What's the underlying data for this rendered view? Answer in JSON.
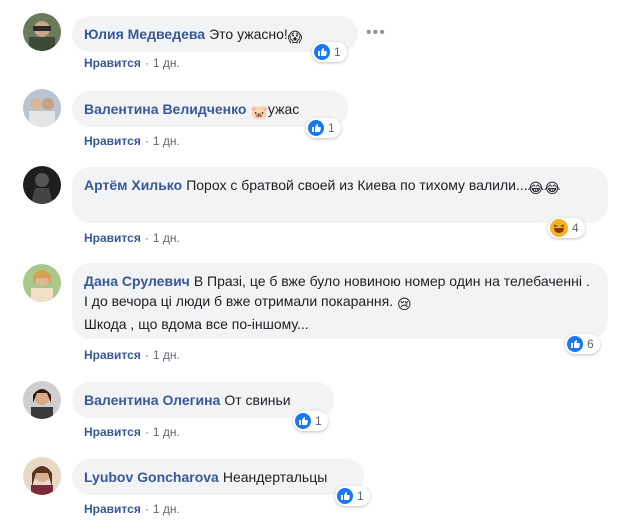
{
  "comments": [
    {
      "author": "Юлия Медведева",
      "text": "Это ужасно!",
      "emoji": "😱",
      "like_label": "Нравится",
      "age": "1 дн.",
      "reaction_count": "1",
      "reaction_type": "like"
    },
    {
      "author": "Валентина Велидченко",
      "text": "ужас",
      "emoji_before": "🐷",
      "like_label": "Нравится",
      "age": "1 дн.",
      "reaction_count": "1",
      "reaction_type": "like"
    },
    {
      "author": "Артём Хилько",
      "text": "Порох с братвой своей из Киева по тихому валили...",
      "emoji": "😂😂",
      "like_label": "Нравится",
      "age": "1 дн.",
      "reaction_count": "4",
      "reaction_type": "laugh"
    },
    {
      "author": "Дана Срулевич",
      "text": "В Празі, це б вже було новиною номер один на телебаченні . І до вечора ці люди б вже отримали покарання.",
      "emoji": "😢",
      "text2": "Шкода , що вдома все по-іншому...",
      "like_label": "Нравится",
      "age": "1 дн.",
      "reaction_count": "6",
      "reaction_type": "like"
    },
    {
      "author": "Валентина Олегина",
      "text": "От свиньи",
      "like_label": "Нравится",
      "age": "1 дн.",
      "reaction_count": "1",
      "reaction_type": "like"
    },
    {
      "author": "Lyubov Goncharova",
      "text": "Неандертальцы",
      "like_label": "Нравится",
      "age": "1 дн.",
      "reaction_count": "1",
      "reaction_type": "like"
    }
  ],
  "colors": {
    "author": "#385898",
    "bubble": "#f2f3f5",
    "like_blue": "#1877f2",
    "meta": "#606770"
  },
  "icons": {
    "like": "thumbs-up-icon",
    "laugh": "laugh-emoji-icon",
    "more": "more-options-icon"
  },
  "more_label": "•••"
}
